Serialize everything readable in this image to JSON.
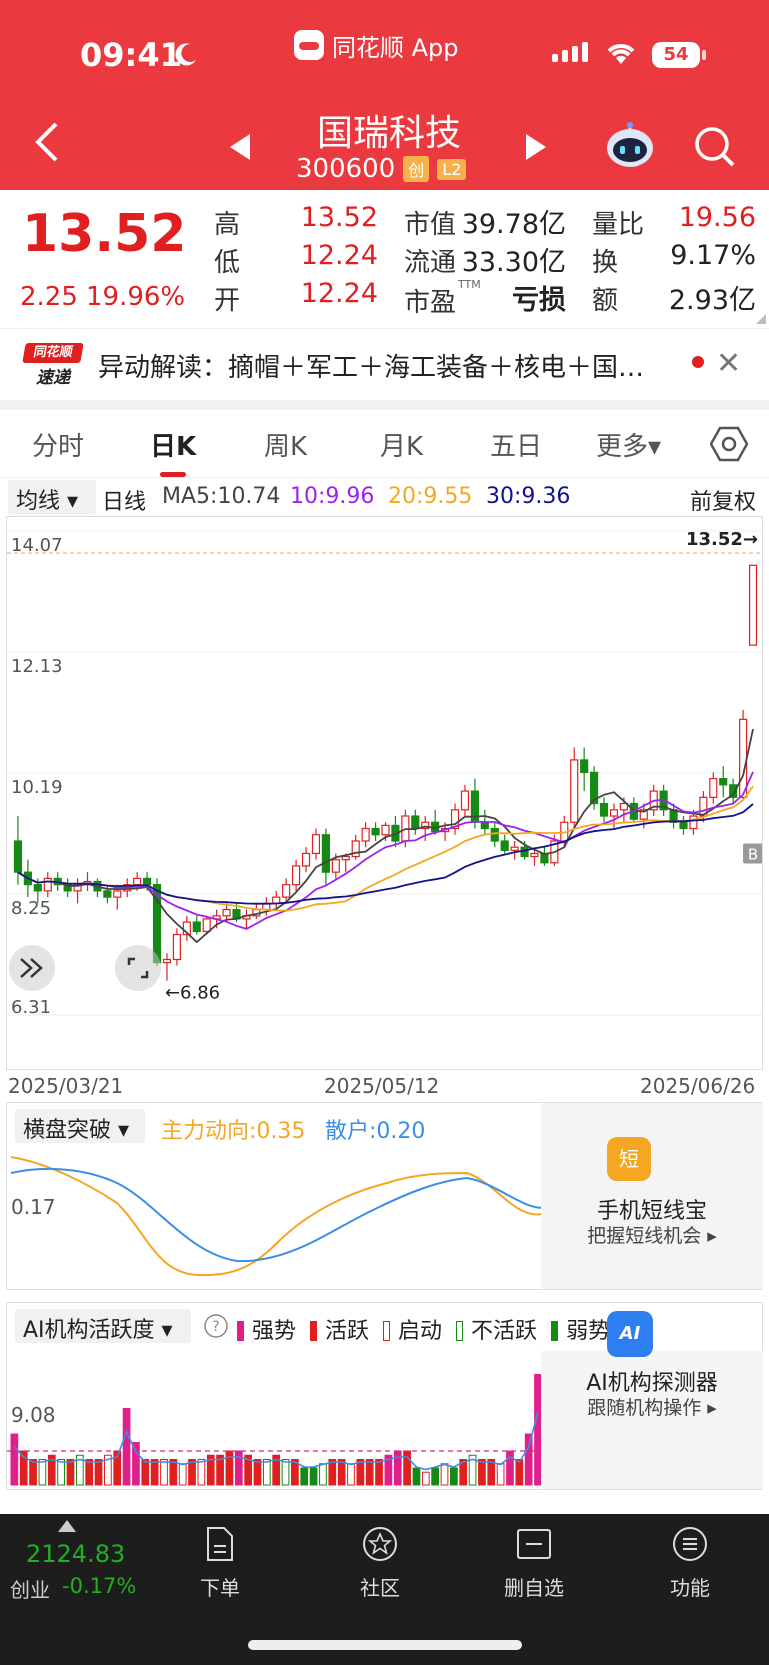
{
  "status_bar": {
    "time": "09:41",
    "app_name": "同花顺 App",
    "battery": "54"
  },
  "header": {
    "stock_name": "国瑞科技",
    "stock_code": "300600",
    "tag_chuang": "创",
    "tag_level": "L2"
  },
  "quote": {
    "price": "13.52",
    "change": "2.25",
    "change_pct": "19.96%",
    "fields": [
      {
        "label": "高",
        "value": "13.52"
      },
      {
        "label": "低",
        "value": "12.24"
      },
      {
        "label": "开",
        "value": "12.24"
      },
      {
        "label": "市值",
        "value": "39.78亿"
      },
      {
        "label": "流通",
        "value": "33.30亿"
      },
      {
        "label": "市盈",
        "sup": "TTM",
        "value": "亏损"
      },
      {
        "label": "量比",
        "value": "19.56"
      },
      {
        "label": "换",
        "value": "9.17%"
      },
      {
        "label": "额",
        "value": "2.93亿"
      }
    ]
  },
  "ticker": {
    "text": "异动解读：摘帽＋军工＋海工装备＋核电＋国…",
    "logo_top": "同花顺",
    "logo_bottom": "速递"
  },
  "tabs": [
    "分时",
    "日K",
    "周K",
    "月K",
    "五日",
    "更多▾"
  ],
  "ma_row": {
    "select": "均线 ▾",
    "type": "日线",
    "ma5": "MA5:10.74",
    "ma10": "10:9.96",
    "ma20": "20:9.55",
    "ma30": "30:9.36",
    "fuquan": "前复权"
  },
  "colors": {
    "up": "#e02020",
    "down": "#148a14",
    "ma5": "#444444",
    "ma10": "#a020f0",
    "ma20": "#f5a623",
    "ma30": "#12128c",
    "header": "#ea3a3f"
  },
  "chart_data": {
    "type": "candlestick",
    "y_ticks": [
      "14.07",
      "12.13",
      "10.19",
      "8.25",
      "6.31"
    ],
    "ylim": [
      6.31,
      14.07
    ],
    "x_labels": [
      "2025/03/21",
      "2025/05/12",
      "2025/06/26"
    ],
    "last_price_label": "13.52→",
    "low_label": "←6.86",
    "marker": "B",
    "ohlc": [
      [
        9.1,
        9.5,
        8.4,
        8.6
      ],
      [
        8.6,
        8.8,
        8.2,
        8.4
      ],
      [
        8.4,
        8.5,
        8.1,
        8.3
      ],
      [
        8.3,
        8.6,
        8.2,
        8.5
      ],
      [
        8.5,
        8.6,
        8.3,
        8.4
      ],
      [
        8.4,
        8.5,
        8.2,
        8.3
      ],
      [
        8.3,
        8.5,
        8.1,
        8.4
      ],
      [
        8.4,
        8.6,
        8.3,
        8.45
      ],
      [
        8.45,
        8.5,
        8.2,
        8.3
      ],
      [
        8.3,
        8.4,
        8.1,
        8.2
      ],
      [
        8.2,
        8.4,
        8.0,
        8.3
      ],
      [
        8.3,
        8.5,
        8.2,
        8.4
      ],
      [
        8.4,
        8.6,
        8.3,
        8.5
      ],
      [
        8.5,
        8.6,
        8.3,
        8.4
      ],
      [
        8.4,
        8.5,
        7.1,
        7.15
      ],
      [
        7.15,
        7.3,
        6.86,
        7.2
      ],
      [
        7.2,
        7.7,
        7.1,
        7.6
      ],
      [
        7.6,
        7.9,
        7.5,
        7.8
      ],
      [
        7.8,
        7.9,
        7.6,
        7.65
      ],
      [
        7.65,
        7.9,
        7.6,
        7.85
      ],
      [
        7.85,
        8.0,
        7.7,
        7.9
      ],
      [
        7.9,
        8.1,
        7.8,
        8.0
      ],
      [
        8.0,
        8.1,
        7.8,
        7.85
      ],
      [
        7.85,
        8.0,
        7.7,
        7.9
      ],
      [
        7.9,
        8.1,
        7.85,
        8.0
      ],
      [
        8.0,
        8.2,
        7.9,
        8.1
      ],
      [
        8.1,
        8.3,
        8.0,
        8.2
      ],
      [
        8.2,
        8.5,
        8.1,
        8.4
      ],
      [
        8.4,
        8.8,
        8.3,
        8.7
      ],
      [
        8.7,
        9.0,
        8.6,
        8.9
      ],
      [
        8.9,
        9.3,
        8.8,
        9.2
      ],
      [
        9.2,
        9.3,
        8.4,
        8.6
      ],
      [
        8.6,
        8.9,
        8.5,
        8.8
      ],
      [
        8.8,
        8.9,
        8.6,
        8.85
      ],
      [
        8.85,
        9.2,
        8.8,
        9.1
      ],
      [
        9.1,
        9.4,
        9.0,
        9.3
      ],
      [
        9.3,
        9.4,
        9.1,
        9.2
      ],
      [
        9.2,
        9.4,
        9.1,
        9.35
      ],
      [
        9.35,
        9.5,
        9.0,
        9.1
      ],
      [
        9.1,
        9.6,
        9.0,
        9.5
      ],
      [
        9.5,
        9.6,
        9.2,
        9.3
      ],
      [
        9.3,
        9.5,
        9.1,
        9.4
      ],
      [
        9.4,
        9.6,
        9.2,
        9.25
      ],
      [
        9.25,
        9.4,
        9.1,
        9.3
      ],
      [
        9.3,
        9.7,
        9.2,
        9.6
      ],
      [
        9.6,
        10.0,
        9.5,
        9.9
      ],
      [
        9.9,
        10.1,
        9.3,
        9.4
      ],
      [
        9.4,
        9.6,
        9.2,
        9.3
      ],
      [
        9.3,
        9.4,
        9.0,
        9.1
      ],
      [
        9.1,
        9.2,
        8.9,
        8.95
      ],
      [
        8.95,
        9.1,
        8.8,
        9.0
      ],
      [
        9.0,
        9.1,
        8.8,
        8.85
      ],
      [
        8.85,
        9.0,
        8.7,
        8.9
      ],
      [
        8.9,
        9.0,
        8.7,
        8.75
      ],
      [
        8.75,
        9.2,
        8.7,
        9.1
      ],
      [
        9.1,
        9.5,
        9.0,
        9.4
      ],
      [
        9.4,
        10.6,
        9.3,
        10.4
      ],
      [
        10.4,
        10.6,
        9.9,
        10.2
      ],
      [
        10.2,
        10.3,
        9.6,
        9.7
      ],
      [
        9.7,
        9.8,
        9.4,
        9.5
      ],
      [
        9.5,
        9.7,
        9.3,
        9.6
      ],
      [
        9.6,
        9.8,
        9.4,
        9.7
      ],
      [
        9.7,
        9.8,
        9.4,
        9.45
      ],
      [
        9.45,
        9.7,
        9.3,
        9.6
      ],
      [
        9.6,
        10.0,
        9.5,
        9.9
      ],
      [
        9.9,
        10.0,
        9.5,
        9.6
      ],
      [
        9.6,
        9.7,
        9.3,
        9.4
      ],
      [
        9.4,
        9.5,
        9.2,
        9.3
      ],
      [
        9.3,
        9.6,
        9.2,
        9.5
      ],
      [
        9.5,
        9.9,
        9.4,
        9.8
      ],
      [
        9.8,
        10.2,
        9.7,
        10.1
      ],
      [
        10.1,
        10.3,
        9.8,
        10.0
      ],
      [
        10.0,
        10.1,
        9.7,
        9.8
      ],
      [
        9.8,
        11.2,
        9.75,
        11.05
      ],
      [
        12.24,
        13.52,
        12.24,
        13.52
      ]
    ]
  },
  "indicator1": {
    "select": "横盘突破 ▾",
    "main": "主力动向:0.35",
    "retail": "散户:0.20",
    "y_label": "0.17",
    "card_title": "手机短线宝",
    "card_sub": "把握短线机会 ▸",
    "card_icon": "短"
  },
  "indicator2": {
    "select": "AI机构活跃度 ▾",
    "legend": [
      "强势",
      "活跃",
      "启动",
      "不活跃",
      "弱势"
    ],
    "y_label": "9.08",
    "card_title": "AI机构探测器",
    "card_sub": "跟随机构操作 ▸",
    "card_icon": "AI"
  },
  "bottom_bar": {
    "index_value": "2124.83",
    "index_name": "创业",
    "index_change": "-0.17%",
    "items": [
      "下单",
      "社区",
      "删自选",
      "功能"
    ]
  }
}
